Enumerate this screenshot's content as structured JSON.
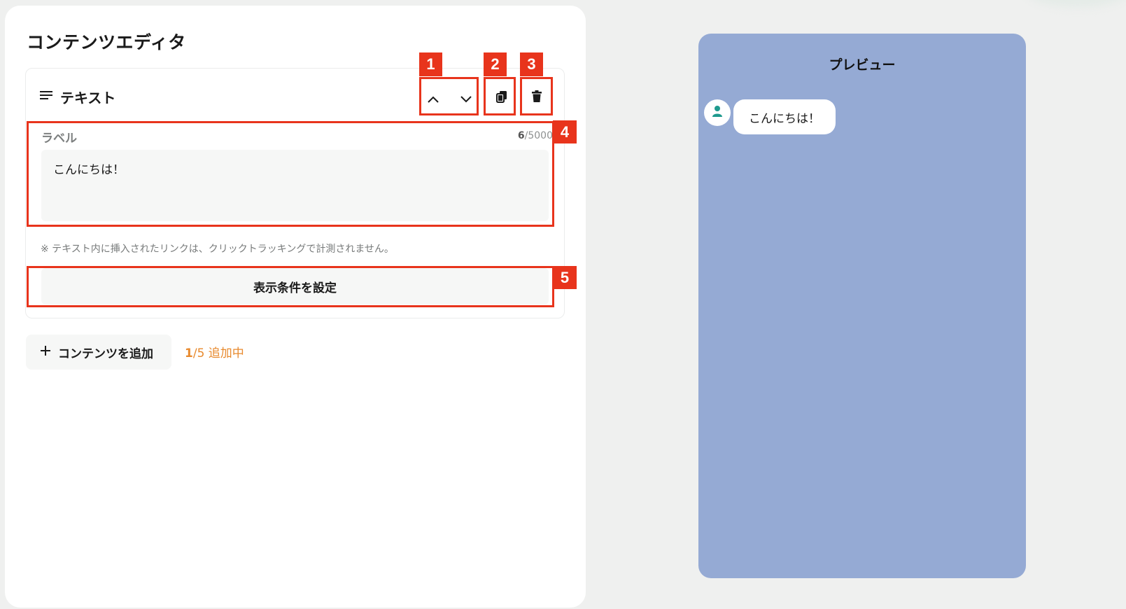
{
  "editor": {
    "title": "コンテンツエディタ",
    "card": {
      "type_label": "テキスト",
      "field_label": "ラベル",
      "char_count_current": "6",
      "char_count_max": "/5000",
      "text_value": "こんにちは！",
      "note": "※ テキスト内に挿入されたリンクは、クリックトラッキングで計測されません。",
      "condition_button": "表示条件を設定"
    },
    "add_button": "コンテンツを追加",
    "add_count_current": "1",
    "add_count_rest": "/5 追加中"
  },
  "annotations": {
    "b1": "1",
    "b2": "2",
    "b3": "3",
    "b4": "4",
    "b5": "5"
  },
  "preview": {
    "title": "プレビュー",
    "message": "こんにちは！"
  },
  "colors": {
    "highlight": "#e8341c",
    "accent_orange": "#e88a2e",
    "preview_bg": "#95aad4",
    "avatar_icon": "#1f9a8e"
  }
}
